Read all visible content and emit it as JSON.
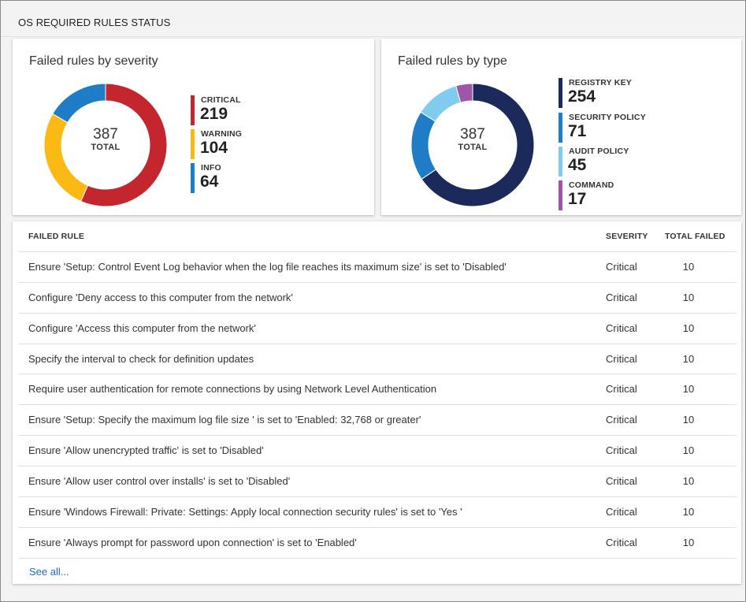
{
  "header": {
    "title": "OS REQUIRED RULES STATUS"
  },
  "severity_chart": {
    "title": "Failed rules by severity",
    "total_value": "387",
    "total_label": "TOTAL",
    "items": [
      {
        "label": "CRITICAL",
        "value": "219",
        "color": "#c4262e"
      },
      {
        "label": "WARNING",
        "value": "104",
        "color": "#fbb913"
      },
      {
        "label": "INFO",
        "value": "64",
        "color": "#1f7cc6"
      }
    ]
  },
  "type_chart": {
    "title": "Failed rules by type",
    "total_value": "387",
    "total_label": "TOTAL",
    "items": [
      {
        "label": "REGISTRY KEY",
        "value": "254",
        "color": "#1b2a5b"
      },
      {
        "label": "SECURITY POLICY",
        "value": "71",
        "color": "#1f7cc6"
      },
      {
        "label": "AUDIT POLICY",
        "value": "45",
        "color": "#7fccef"
      },
      {
        "label": "COMMAND",
        "value": "17",
        "color": "#9e57a8"
      }
    ]
  },
  "table": {
    "headers": {
      "rule": "FAILED RULE",
      "severity": "SEVERITY",
      "total": "TOTAL FAILED"
    },
    "rows": [
      {
        "rule": "Ensure 'Setup: Control Event Log behavior when the log file reaches its maximum size' is set to 'Disabled'",
        "severity": "Critical",
        "total": "10"
      },
      {
        "rule": "Configure 'Deny access to this computer from the network'",
        "severity": "Critical",
        "total": "10"
      },
      {
        "rule": "Configure 'Access this computer from the network'",
        "severity": "Critical",
        "total": "10"
      },
      {
        "rule": "Specify the interval to check for definition updates",
        "severity": "Critical",
        "total": "10"
      },
      {
        "rule": "Require user authentication for remote connections by using Network Level Authentication",
        "severity": "Critical",
        "total": "10"
      },
      {
        "rule": "Ensure 'Setup: Specify the maximum log file size ' is set to 'Enabled: 32,768 or greater'",
        "severity": "Critical",
        "total": "10"
      },
      {
        "rule": "Ensure 'Allow unencrypted traffic' is set to 'Disabled'",
        "severity": "Critical",
        "total": "10"
      },
      {
        "rule": "Ensure 'Allow user control over installs' is set to 'Disabled'",
        "severity": "Critical",
        "total": "10"
      },
      {
        "rule": "Ensure 'Windows Firewall: Private: Settings: Apply local connection security rules' is set to 'Yes '",
        "severity": "Critical",
        "total": "10"
      },
      {
        "rule": "Ensure 'Always prompt for password upon connection' is set to 'Enabled'",
        "severity": "Critical",
        "total": "10"
      }
    ],
    "see_all": "See all..."
  }
}
